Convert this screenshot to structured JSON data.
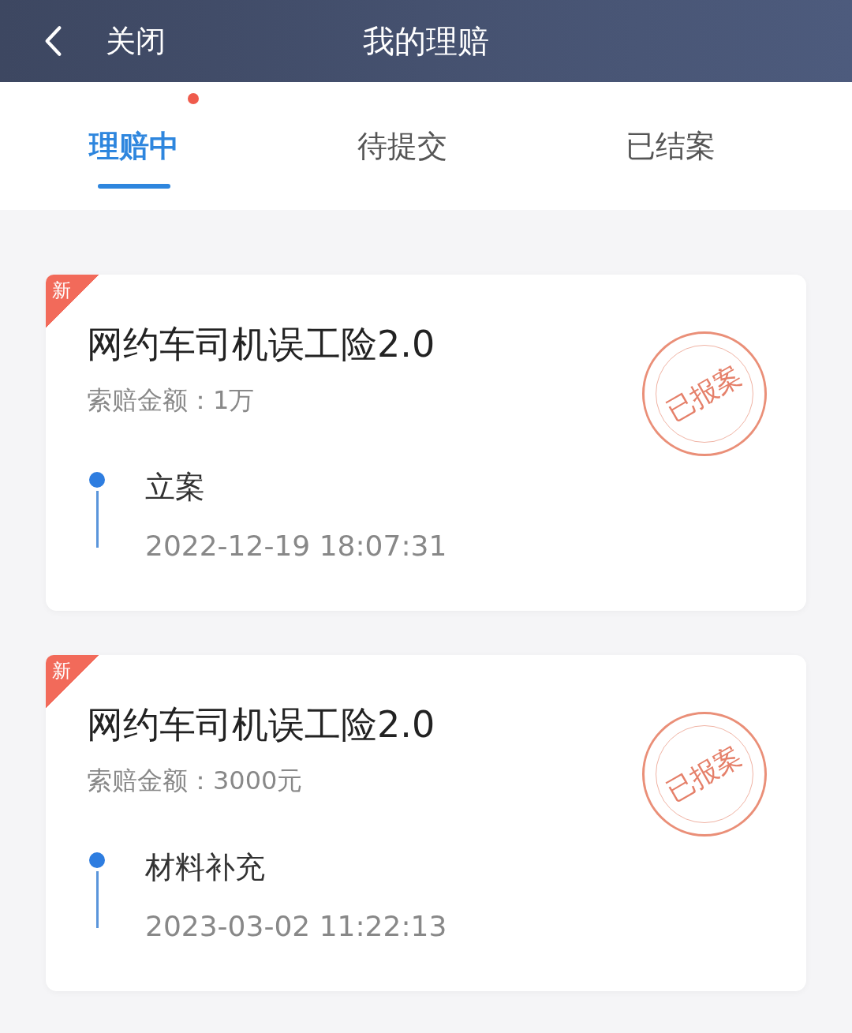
{
  "header": {
    "back_label": "关闭",
    "title": "我的理赔"
  },
  "tabs": [
    {
      "label": "理赔中",
      "selected": true,
      "badge_dot": true
    },
    {
      "label": "待提交",
      "selected": false,
      "badge_dot": false
    },
    {
      "label": "已结案",
      "selected": false,
      "badge_dot": false
    }
  ],
  "claims": [
    {
      "tag": "新",
      "title": "网约车司机误工险2.0",
      "amount_label": "索赔金额：",
      "amount": "1万",
      "stamp": "已报案",
      "step": "立案",
      "time": "2022-12-19 18:07:31"
    },
    {
      "tag": "新",
      "title": "网约车司机误工险2.0",
      "amount_label": "索赔金额：",
      "amount": "3000元",
      "stamp": "已报案",
      "step": "材料补充",
      "time": "2023-03-02 11:22:13"
    }
  ]
}
